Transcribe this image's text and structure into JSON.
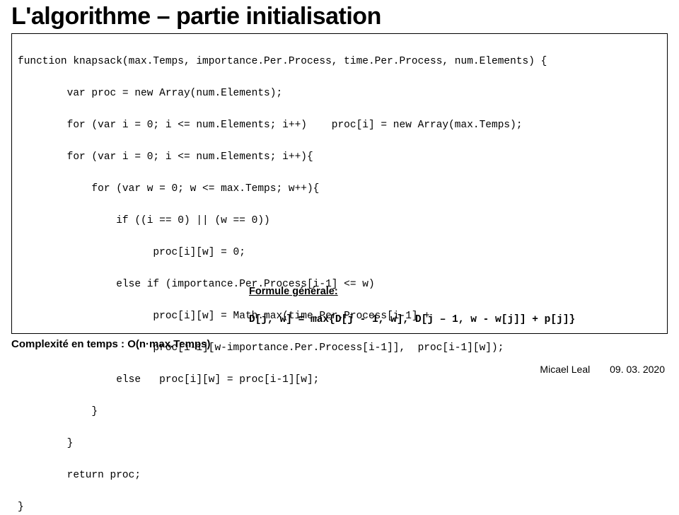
{
  "title": "L'algorithme – partie initialisation",
  "code": {
    "l0": "function knapsack(max.Temps, importance.Per.Process, time.Per.Process, num.Elements) {",
    "l1": "        var proc = new Array(num.Elements);",
    "l2": "        for (var i = 0; i <= num.Elements; i++)    proc[i] = new Array(max.Temps);",
    "l3": "        for (var i = 0; i <= num.Elements; i++){",
    "l4": "            for (var w = 0; w <= max.Temps; w++){",
    "l5": "                if ((i == 0) || (w == 0))",
    "l6": "                      proc[i][w] = 0;",
    "l7": "                else if (importance.Per.Process[i-1] <= w)",
    "l8": "                      proc[i][w] = Math.max(time.Per.Process[i-1] +",
    "l9": "                      proc[i-1][w-importance.Per.Process[i-1]],  proc[i-1][w]);",
    "l10": "                else   proc[i][w] = proc[i-1][w];",
    "l11": "            }",
    "l12": "        }",
    "l13": "        return proc;",
    "l14": "}"
  },
  "formula": {
    "caption": "Formule générale:",
    "expr": "D[j, w] = max{D[j - 1, w], D[j – 1, w - w[j]] + p[j]}"
  },
  "complexity": "Complexité en temps : O(n·max.Temps)",
  "footer": {
    "author": "Micael Leal",
    "date": "09. 03. 2020"
  }
}
